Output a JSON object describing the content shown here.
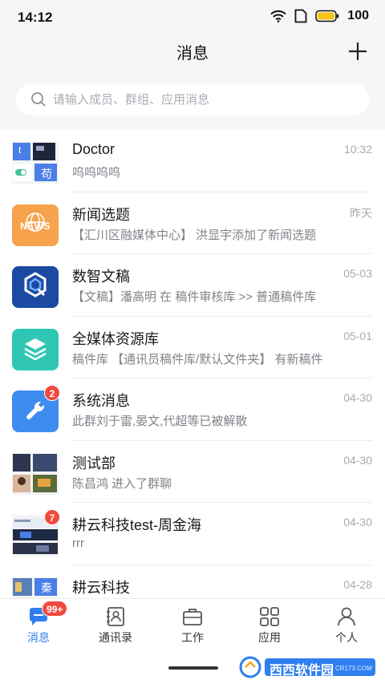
{
  "status_bar": {
    "time": "14:12",
    "battery": "100",
    "battery_color": "#f5c518"
  },
  "header": {
    "title": "消息"
  },
  "search": {
    "placeholder": "请输入成员、群组、应用消息"
  },
  "conversations": [
    {
      "name": "Doctor",
      "preview": "呜呜呜呜",
      "time": "10:32",
      "avatar": "group-collage-icon",
      "avatar_text": [
        "t",
        "苟"
      ]
    },
    {
      "name": "新闻选题",
      "preview": "【汇川区融媒体中心】 洪显宇添加了新闻选题",
      "time": "昨天",
      "avatar": "news-app-icon",
      "avatar_text": "NEWS",
      "avatar_color": "#f7a24c"
    },
    {
      "name": "数智文稿",
      "preview": "【文稿】潘高明 在 稿件审核库 >> 普通稿件库",
      "time": "05-03",
      "avatar": "document-app-icon",
      "avatar_color": "#1c4aa3"
    },
    {
      "name": "全媒体资源库",
      "preview": "稿件库 【通讯员稿件库/默认文件夹】 有新稿件",
      "time": "05-01",
      "avatar": "layers-app-icon",
      "avatar_color": "#2fc7b4"
    },
    {
      "name": "系统消息",
      "preview": "此群刘于雷,晏文,代超等已被解散",
      "time": "04-30",
      "avatar": "wrench-app-icon",
      "avatar_color": "#3f8cf0",
      "badge": "2"
    },
    {
      "name": "测试部",
      "preview": "陈昌鸿 进入了群聊",
      "time": "04-30",
      "avatar": "group-collage-icon"
    },
    {
      "name": "耕云科技test-周金海",
      "preview": "rrr",
      "time": "04-30",
      "avatar": "group-collage-icon",
      "badge": "7"
    },
    {
      "name": "耕云科技",
      "preview": "",
      "time": "04-28",
      "avatar": "group-collage-icon",
      "avatar_text": "秦"
    }
  ],
  "tabs": [
    {
      "label": "消息",
      "icon": "chat-icon",
      "active": true,
      "badge": "99+"
    },
    {
      "label": "通讯录",
      "icon": "contacts-icon",
      "active": false
    },
    {
      "label": "工作",
      "icon": "briefcase-icon",
      "active": false
    },
    {
      "label": "应用",
      "icon": "apps-grid-icon",
      "active": false
    },
    {
      "label": "个人",
      "icon": "person-icon",
      "active": false
    }
  ],
  "colors": {
    "accent": "#2f7ff0",
    "badge": "#f04a3e",
    "header_bg": "#f5f6f8"
  },
  "watermark": {
    "logo": "西西软件园",
    "sub": "CR173.COM"
  }
}
